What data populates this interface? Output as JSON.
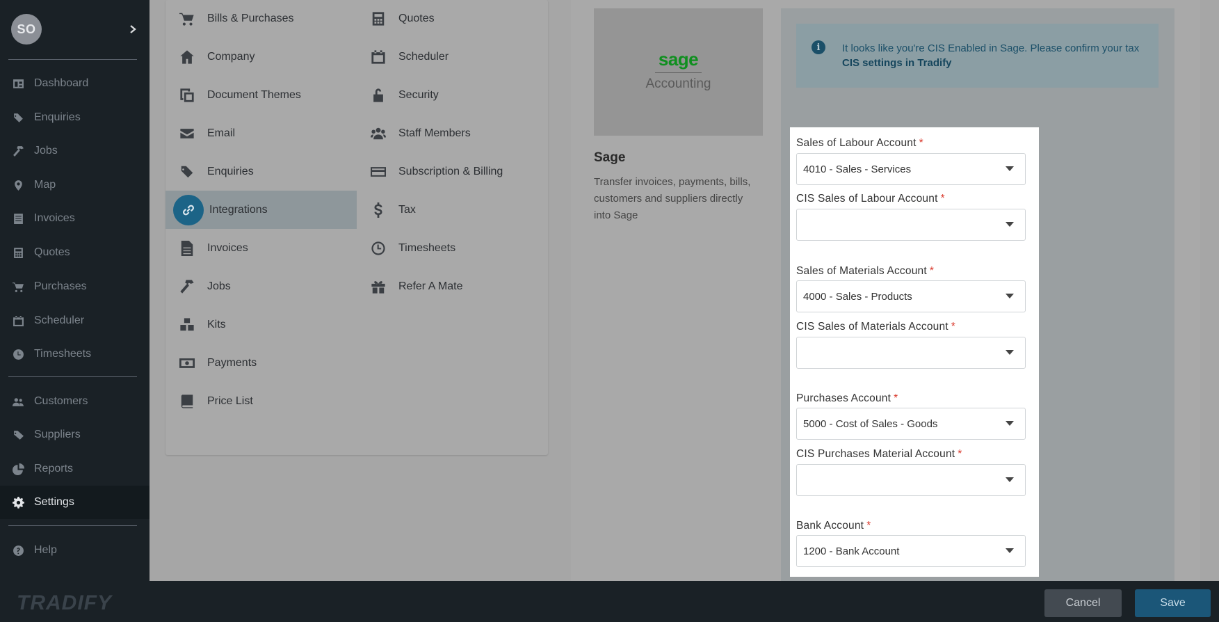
{
  "sidebar": {
    "avatar_initials": "SO",
    "items": [
      {
        "label": "Dashboard",
        "icon": "dashboard-icon"
      },
      {
        "label": "Enquiries",
        "icon": "tags-icon"
      },
      {
        "label": "Jobs",
        "icon": "hammer-icon"
      },
      {
        "label": "Map",
        "icon": "map-marker-icon"
      },
      {
        "label": "Invoices",
        "icon": "invoice-icon"
      },
      {
        "label": "Quotes",
        "icon": "calculator-icon"
      },
      {
        "label": "Purchases",
        "icon": "cart-icon"
      },
      {
        "label": "Scheduler",
        "icon": "calendar-icon"
      },
      {
        "label": "Timesheets",
        "icon": "clock-icon"
      },
      {
        "label": "Customers",
        "icon": "users-icon"
      },
      {
        "label": "Suppliers",
        "icon": "tag-icon"
      },
      {
        "label": "Reports",
        "icon": "pie-chart-icon"
      },
      {
        "label": "Settings",
        "icon": "gear-icon",
        "active": true
      },
      {
        "label": "Help",
        "icon": "question-icon"
      }
    ],
    "brand": "TRADIFY"
  },
  "settings_menu": {
    "left_column": [
      {
        "label": "Bills & Purchases",
        "icon": "cart-icon"
      },
      {
        "label": "Company",
        "icon": "home-icon"
      },
      {
        "label": "Document Themes",
        "icon": "copy-icon"
      },
      {
        "label": "Email",
        "icon": "envelope-icon"
      },
      {
        "label": "Enquiries",
        "icon": "tags-icon"
      },
      {
        "label": "Integrations",
        "icon": "link-icon",
        "active": true
      },
      {
        "label": "Invoices",
        "icon": "file-icon"
      },
      {
        "label": "Jobs",
        "icon": "hammer-icon"
      },
      {
        "label": "Kits",
        "icon": "cubes-icon"
      },
      {
        "label": "Payments",
        "icon": "money-icon"
      },
      {
        "label": "Price List",
        "icon": "book-icon"
      }
    ],
    "right_column": [
      {
        "label": "Quotes",
        "icon": "calculator-icon"
      },
      {
        "label": "Scheduler",
        "icon": "calendar-icon"
      },
      {
        "label": "Security",
        "icon": "lock-icon"
      },
      {
        "label": "Staff Members",
        "icon": "users-icon"
      },
      {
        "label": "Subscription & Billing",
        "icon": "credit-card-icon"
      },
      {
        "label": "Tax",
        "icon": "dollar-icon"
      },
      {
        "label": "Timesheets",
        "icon": "clock-icon"
      },
      {
        "label": "Refer A Mate",
        "icon": "gift-icon"
      }
    ]
  },
  "integration": {
    "logo_word": "sage",
    "logo_sub": "Accounting",
    "title": "Sage",
    "description": "Transfer invoices, payments, bills, customers and suppliers directly into Sage",
    "notice_text": "It looks like you're CIS Enabled in Sage. Please confirm your tax",
    "notice_link": "CIS settings in Tradify"
  },
  "form": {
    "required_mark": "*",
    "fields": [
      {
        "label": "Sales of Labour Account",
        "value": ""
      },
      {
        "label": "CIS Sales of Labour Account",
        "value": ""
      },
      {
        "label": "Sales of Materials Account",
        "value": ""
      },
      {
        "label": "CIS Sales of Materials Account",
        "value": ""
      },
      {
        "label": "Purchases Account",
        "value": ""
      },
      {
        "label": "CIS Purchases Material Account",
        "value": ""
      },
      {
        "label": "Bank Account",
        "value": ""
      }
    ],
    "values": {
      "sales_labour": "4010 - Sales - Services",
      "cis_sales_labour": "",
      "sales_materials": "4000 - Sales - Products",
      "cis_sales_materials": "",
      "purchases": "5000 - Cost of Sales - Goods",
      "cis_purchases": "",
      "bank": "1200 - Bank Account"
    }
  },
  "footer": {
    "cancel_label": "Cancel",
    "save_label": "Save"
  }
}
